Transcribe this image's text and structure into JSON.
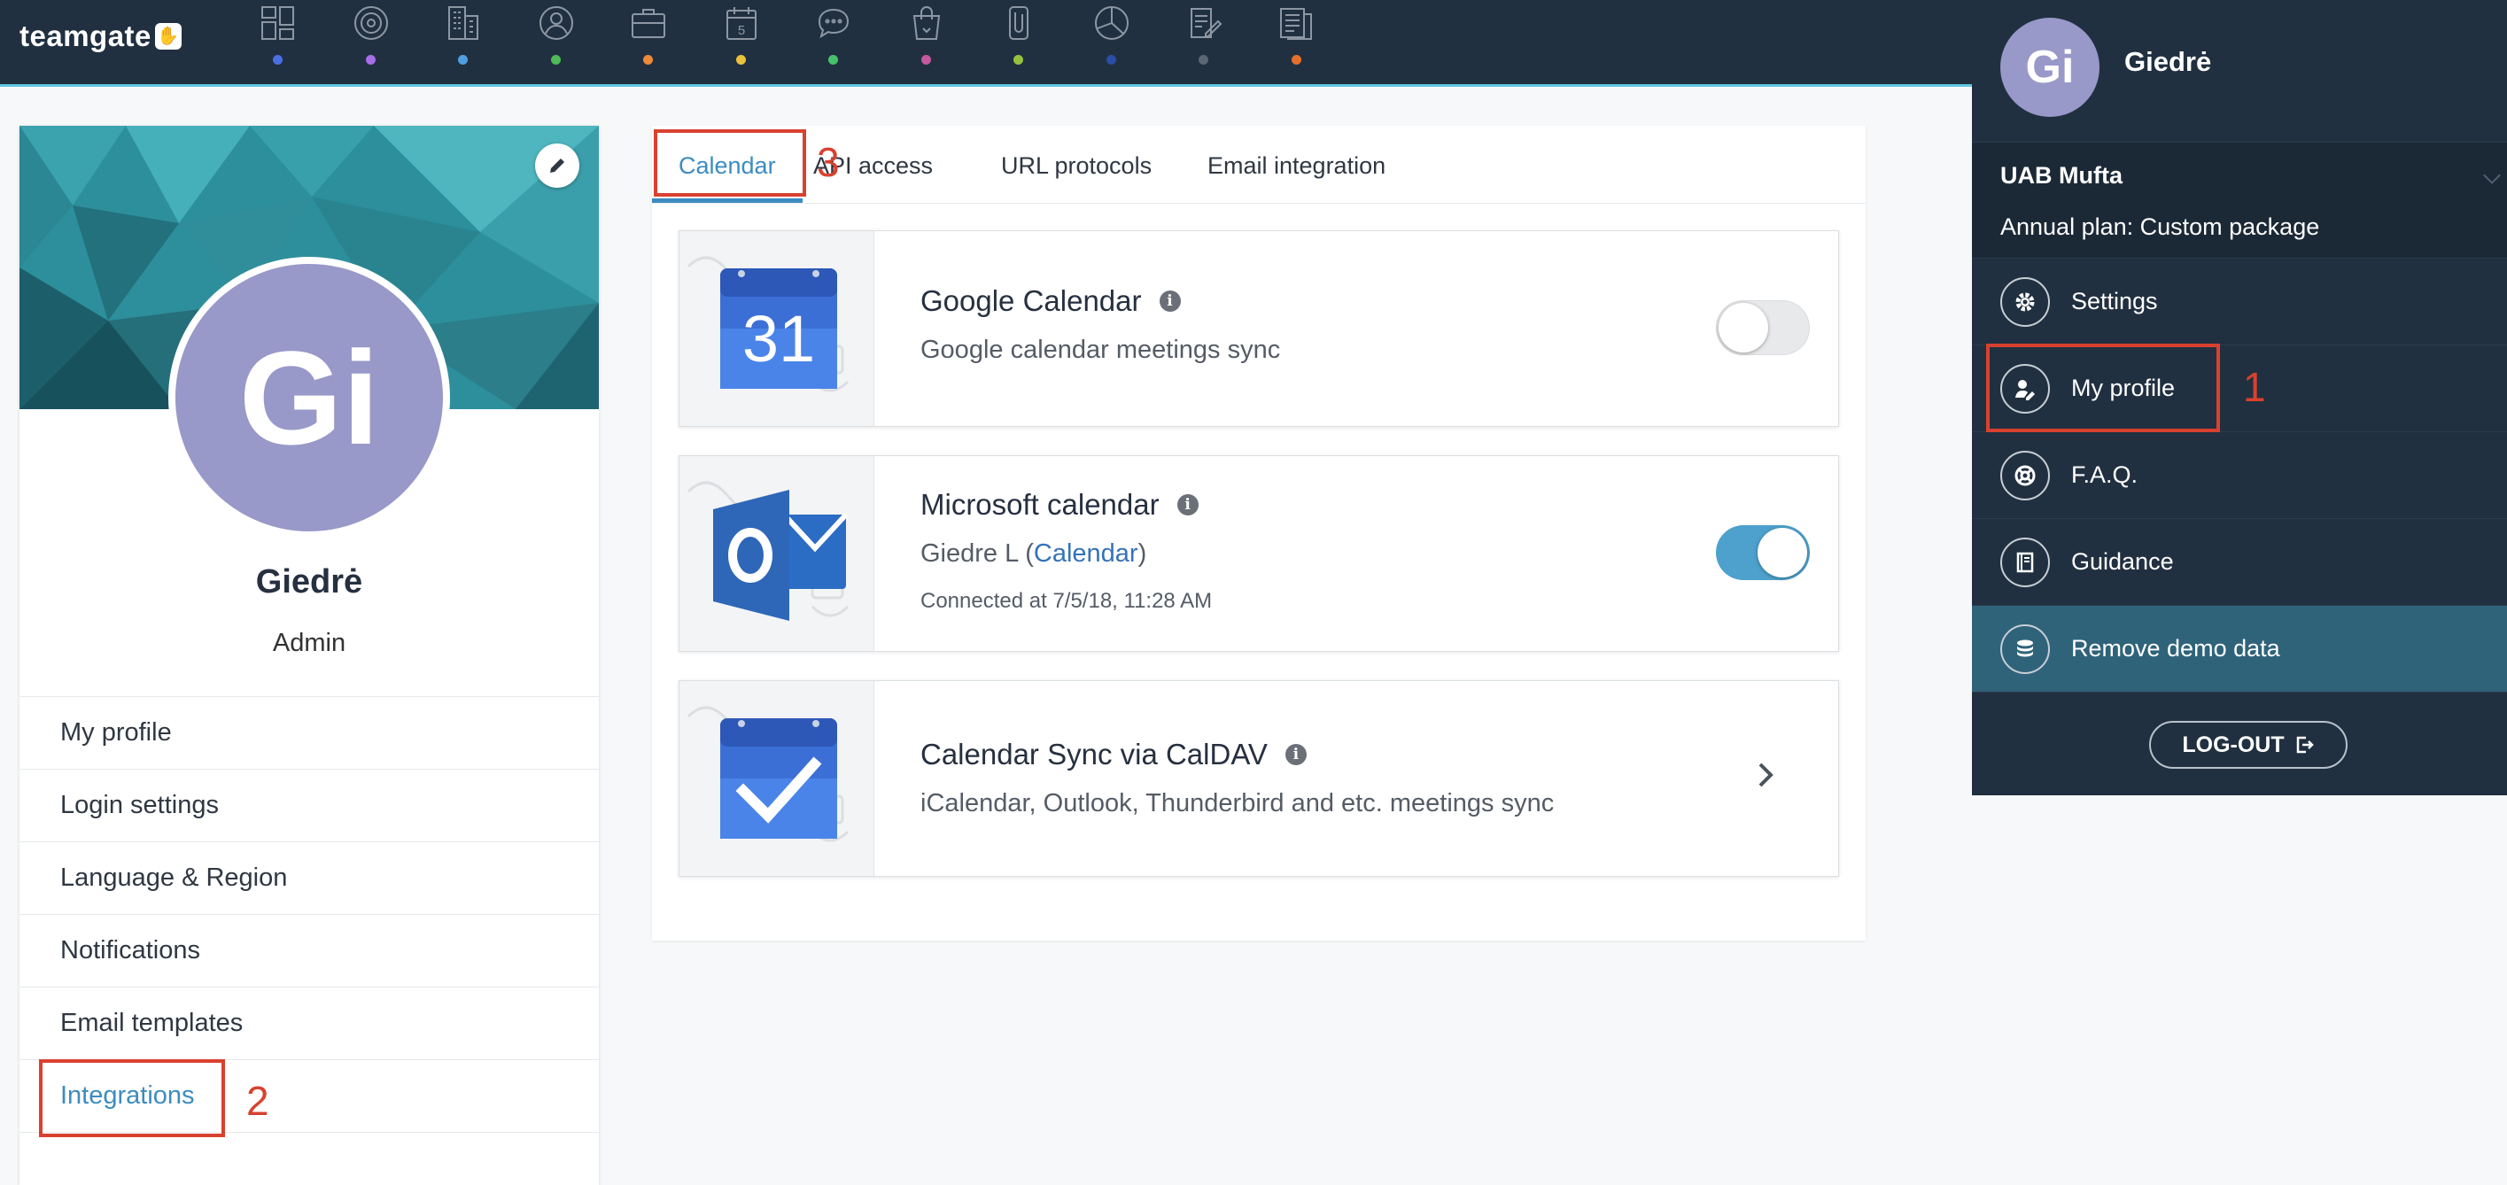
{
  "app": {
    "logo_text": "teamgate",
    "logo_icon": "hand-icon"
  },
  "nav": {
    "items": [
      {
        "icon": "dashboard-icon",
        "dot_color": "#4a6fe3"
      },
      {
        "icon": "target-icon",
        "dot_color": "#a86ee8"
      },
      {
        "icon": "building-icon",
        "dot_color": "#4f9fe0"
      },
      {
        "icon": "contact-icon",
        "dot_color": "#4dbb56"
      },
      {
        "icon": "briefcase-icon",
        "dot_color": "#ec8a38"
      },
      {
        "icon": "calendar-icon",
        "dot_color": "#e9c23a"
      },
      {
        "icon": "chat-icon",
        "dot_color": "#47c06a"
      },
      {
        "icon": "shopping-bag-icon",
        "dot_color": "#c45a9c"
      },
      {
        "icon": "clip-icon",
        "dot_color": "#94c23f"
      },
      {
        "icon": "pie-chart-icon",
        "dot_color": "#2a4ea8"
      },
      {
        "icon": "edit-document-icon",
        "dot_color": "#5a6672"
      },
      {
        "icon": "report-icon",
        "dot_color": "#e5702e"
      }
    ]
  },
  "profile": {
    "initials": "Gi",
    "name": "Giedrė",
    "role": "Admin",
    "avatar_color": "#9898c9"
  },
  "profile_menu": {
    "items": [
      {
        "label": "My profile"
      },
      {
        "label": "Login settings"
      },
      {
        "label": "Language & Region"
      },
      {
        "label": "Notifications"
      },
      {
        "label": "Email templates"
      },
      {
        "label": "Integrations",
        "active": true
      }
    ]
  },
  "tabs": [
    {
      "label": "Calendar",
      "active": true
    },
    {
      "label": "API access"
    },
    {
      "label": "URL protocols"
    },
    {
      "label": "Email integration"
    }
  ],
  "integrations": {
    "google": {
      "title": "Google Calendar",
      "subtitle": "Google calendar meetings sync",
      "icon_day": "31",
      "enabled": false
    },
    "microsoft": {
      "title": "Microsoft calendar",
      "subtitle_prefix": "Giedre L (",
      "subtitle_link": "Calendar",
      "subtitle_suffix": ")",
      "connected": "Connected at 7/5/18, 11:28 AM",
      "icon_letter": "O",
      "enabled": true
    },
    "caldav": {
      "title": "Calendar Sync via CalDAV",
      "subtitle": "iCalendar, Outlook, Thunderbird and etc. meetings sync"
    }
  },
  "dropdown": {
    "initials": "Gi",
    "name": "Giedrė",
    "company": "UAB Mufta",
    "plan": "Annual plan: Custom package",
    "items": [
      {
        "label": "Settings",
        "icon": "gear-icon"
      },
      {
        "label": "My profile",
        "icon": "profile-icon"
      },
      {
        "label": "F.A.Q.",
        "icon": "lifebuoy-icon"
      },
      {
        "label": "Guidance",
        "icon": "book-icon"
      },
      {
        "label": "Remove demo data",
        "icon": "database-icon",
        "highlight": true
      }
    ],
    "logout": "LOG-OUT"
  },
  "annotations": {
    "n1": "1",
    "n2": "2",
    "n3": "3",
    "color": "#d9412f"
  },
  "colors": {
    "topbar": "#213040",
    "accent": "#3c8cc0",
    "toggle_on": "#4da1cc"
  }
}
